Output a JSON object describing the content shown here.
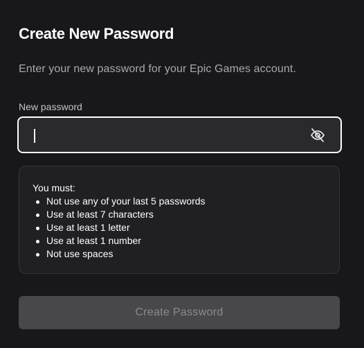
{
  "page": {
    "title": "Create New Password",
    "subtitle": "Enter your new password for your Epic Games account."
  },
  "password_field": {
    "label": "New password",
    "value": "",
    "toggle_icon": "eye-slash-icon"
  },
  "requirements": {
    "heading": "You must:",
    "items": [
      "Not use any of your last 5 passwords",
      "Use at least 7 characters",
      "Use at least 1 letter",
      "Use at least 1 number",
      "Not use spaces"
    ]
  },
  "submit_button": {
    "label": "Create Password",
    "disabled": true
  },
  "colors": {
    "background": "#18181c",
    "input_bg": "#2a2a2e",
    "input_border_focus": "#ffffff",
    "rules_bg": "#202024",
    "button_bg_disabled": "#48484c",
    "button_text_disabled": "#8a8a8f"
  }
}
